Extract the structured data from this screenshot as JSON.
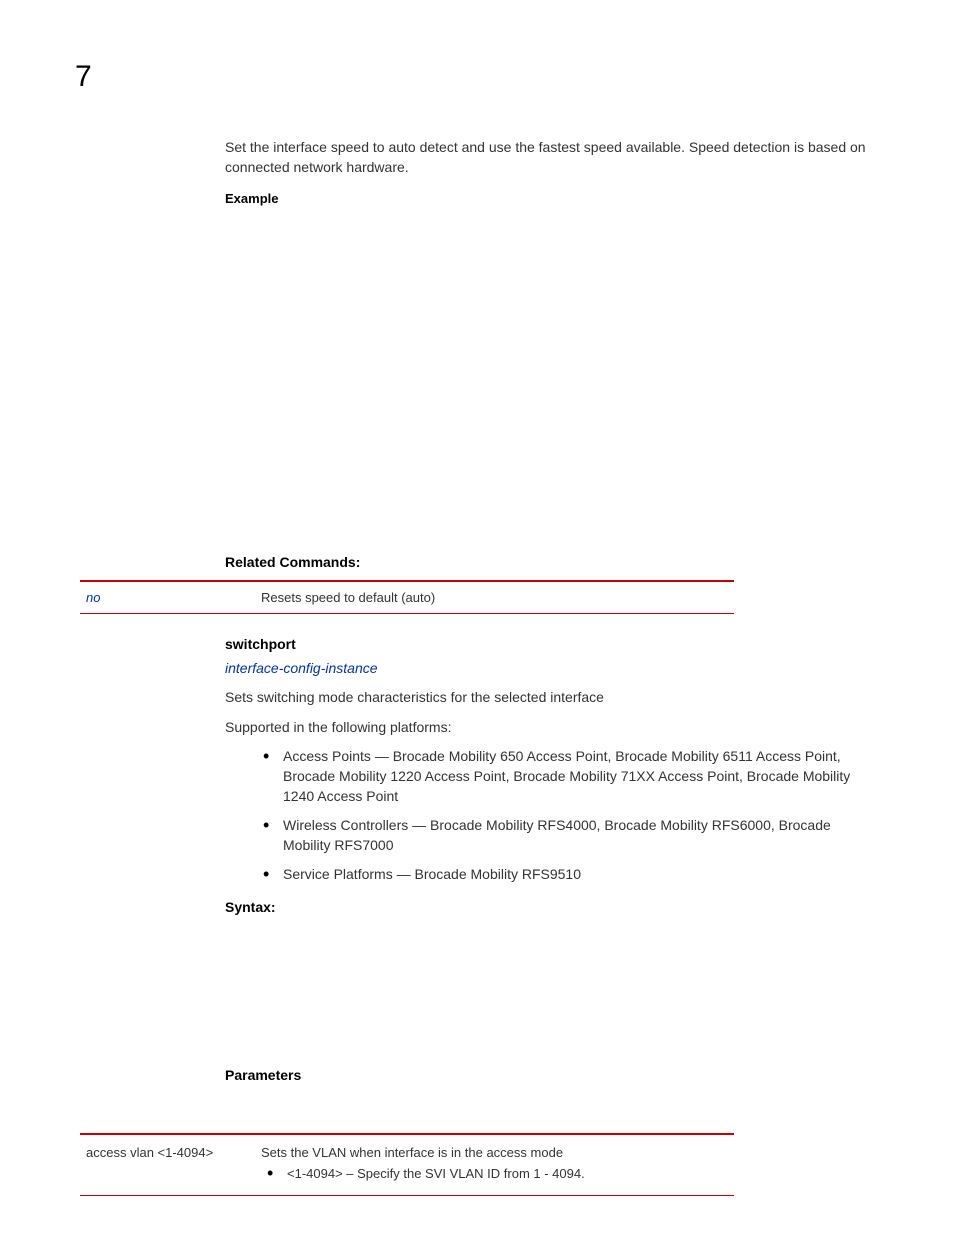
{
  "page_number": "7",
  "intro_para": "Set the interface speed to auto detect and use the fastest speed available. Speed detection is based on connected network hardware.",
  "example_heading": "Example",
  "related_commands_heading": "Related Commands:",
  "related_commands_table": {
    "command": "no",
    "description": "Resets speed to default (auto)"
  },
  "switchport_heading": "switchport",
  "switchport_link": "interface-config-instance",
  "switchport_desc": "Sets switching mode characteristics for the selected interface",
  "supported_text": "Supported in the following platforms:",
  "platforms": {
    "ap": "Access Points — Brocade Mobility 650 Access Point, Brocade Mobility 6511 Access Point, Brocade Mobility 1220 Access Point, Brocade Mobility 71XX Access Point, Brocade Mobility 1240 Access Point",
    "wc": "Wireless Controllers — Brocade Mobility RFS4000, Brocade Mobility RFS6000, Brocade Mobility RFS7000",
    "sp": "Service Platforms — Brocade Mobility RFS9510"
  },
  "syntax_heading": "Syntax:",
  "parameters_heading": "Parameters",
  "params_table": {
    "param": "access vlan <1-4094>",
    "desc": "Sets the VLAN when interface is in the access mode",
    "sub": "<1-4094> – Specify the SVI VLAN ID from 1 - 4094."
  }
}
